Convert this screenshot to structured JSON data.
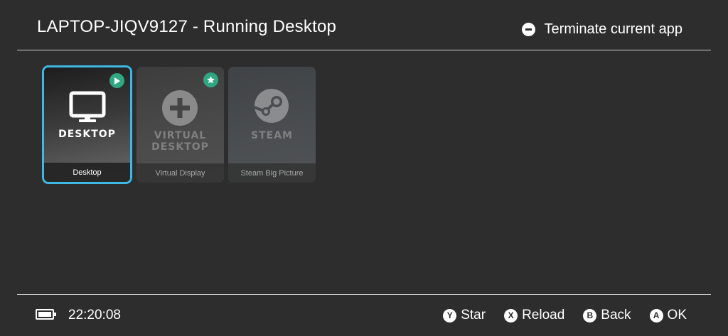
{
  "header": {
    "title": "LAPTOP-JIQV9127 - Running Desktop",
    "terminate_label": "Terminate current app",
    "terminate_icon": "minus-circle-icon"
  },
  "apps": [
    {
      "name_line1": "DESKTOP",
      "name_line2": "",
      "label": "Desktop",
      "badge": "play-icon",
      "selected": true
    },
    {
      "name_line1": "VIRTUAL",
      "name_line2": "DESKTOP",
      "label": "Virtual Display",
      "badge": "star-icon",
      "selected": false
    },
    {
      "name_line1": "STEAM",
      "name_line2": "",
      "label": "Steam Big Picture",
      "badge": "",
      "selected": false
    }
  ],
  "footer": {
    "time": "22:20:08",
    "battery_icon": "battery-full-icon",
    "hints": [
      {
        "button": "Y",
        "label": "Star"
      },
      {
        "button": "X",
        "label": "Reload"
      },
      {
        "button": "B",
        "label": "Back"
      },
      {
        "button": "A",
        "label": "OK"
      }
    ]
  },
  "colors": {
    "background": "#2d2d2d",
    "selection": "#3eb8e4",
    "badge": "#2fa782"
  }
}
